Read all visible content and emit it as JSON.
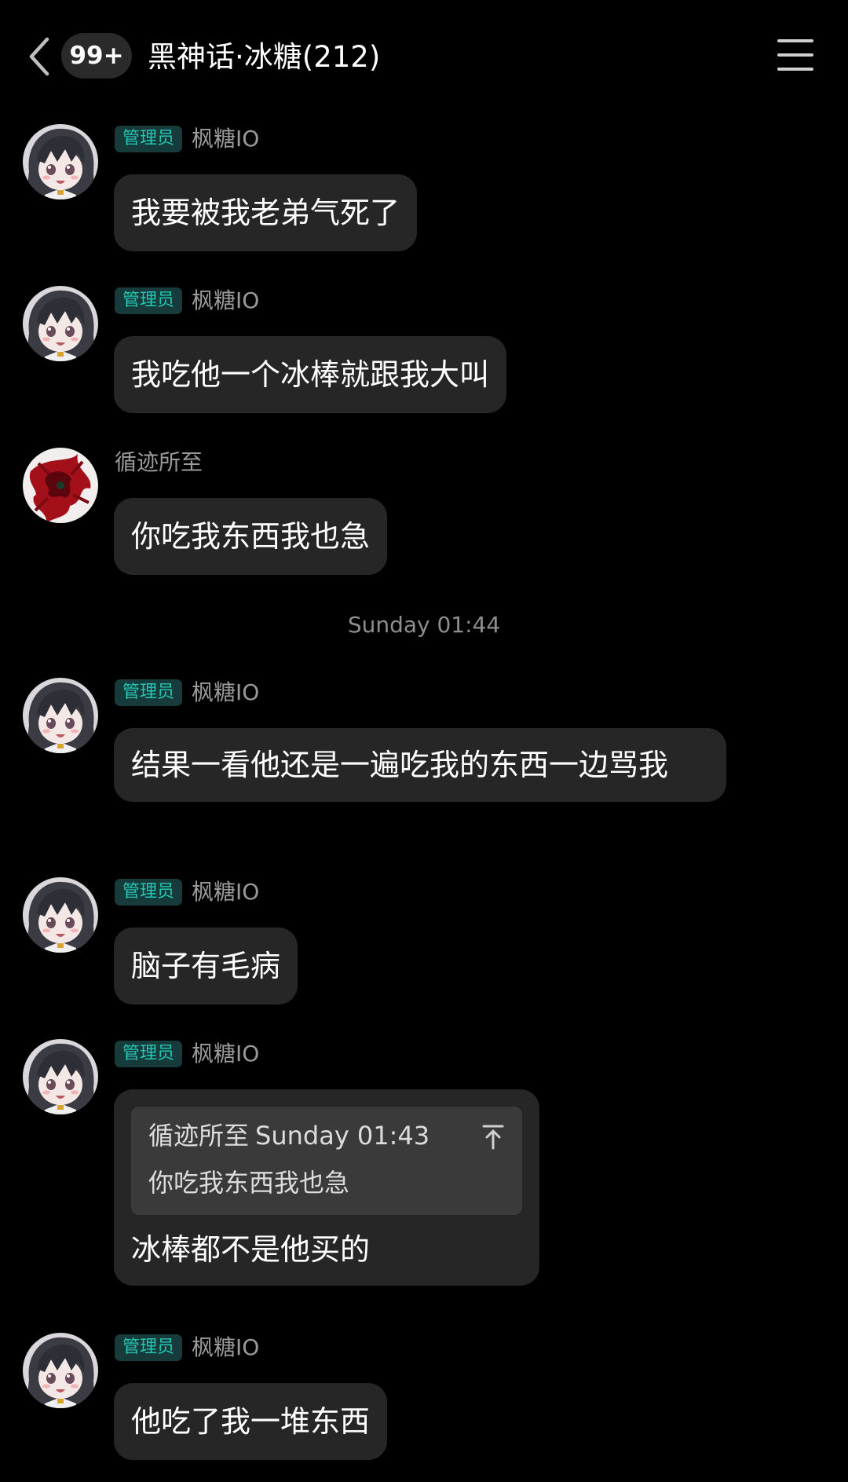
{
  "header": {
    "unread_count": "99+",
    "title": "黑神话·冰糖(212)"
  },
  "messages": [
    {
      "sender": "枫糖IO",
      "role": "管理员",
      "avatar": "anime-girl-avatar",
      "text": "我要被我老弟气死了"
    },
    {
      "sender": "枫糖IO",
      "role": "管理员",
      "avatar": "anime-girl-avatar",
      "text": "我吃他一个冰棒就跟我大叫"
    },
    {
      "sender": "循迹所至",
      "role": "",
      "avatar": "red-figure-avatar",
      "text": "你吃我东西我也急"
    },
    {
      "sender": "枫糖IO",
      "role": "管理员",
      "avatar": "anime-girl-avatar",
      "text": "结果一看他还是一遍吃我的东西一边骂我"
    },
    {
      "sender": "枫糖IO",
      "role": "管理员",
      "avatar": "anime-girl-avatar",
      "text": "脑子有毛病"
    },
    {
      "sender": "枫糖IO",
      "role": "管理员",
      "avatar": "anime-girl-avatar",
      "quote": {
        "sender": "循迹所至",
        "time": "Sunday 01:43",
        "text": "你吃我东西我也急"
      },
      "text": "冰棒都不是他买的"
    },
    {
      "sender": "枫糖IO",
      "role": "管理员",
      "avatar": "anime-girl-avatar",
      "text": "他吃了我一堆东西"
    }
  ],
  "separator": {
    "timestamp": "Sunday 01:44"
  },
  "colors": {
    "background": "#000000",
    "bubble": "#262626",
    "role_badge_text": "#23c7b5",
    "role_badge_bg": "#173b3b",
    "name_text": "#9a9a9a"
  },
  "icons": {
    "back": "chevron-left-icon",
    "menu": "hamburger-menu-icon",
    "quote_jump": "jump-to-top-icon"
  }
}
